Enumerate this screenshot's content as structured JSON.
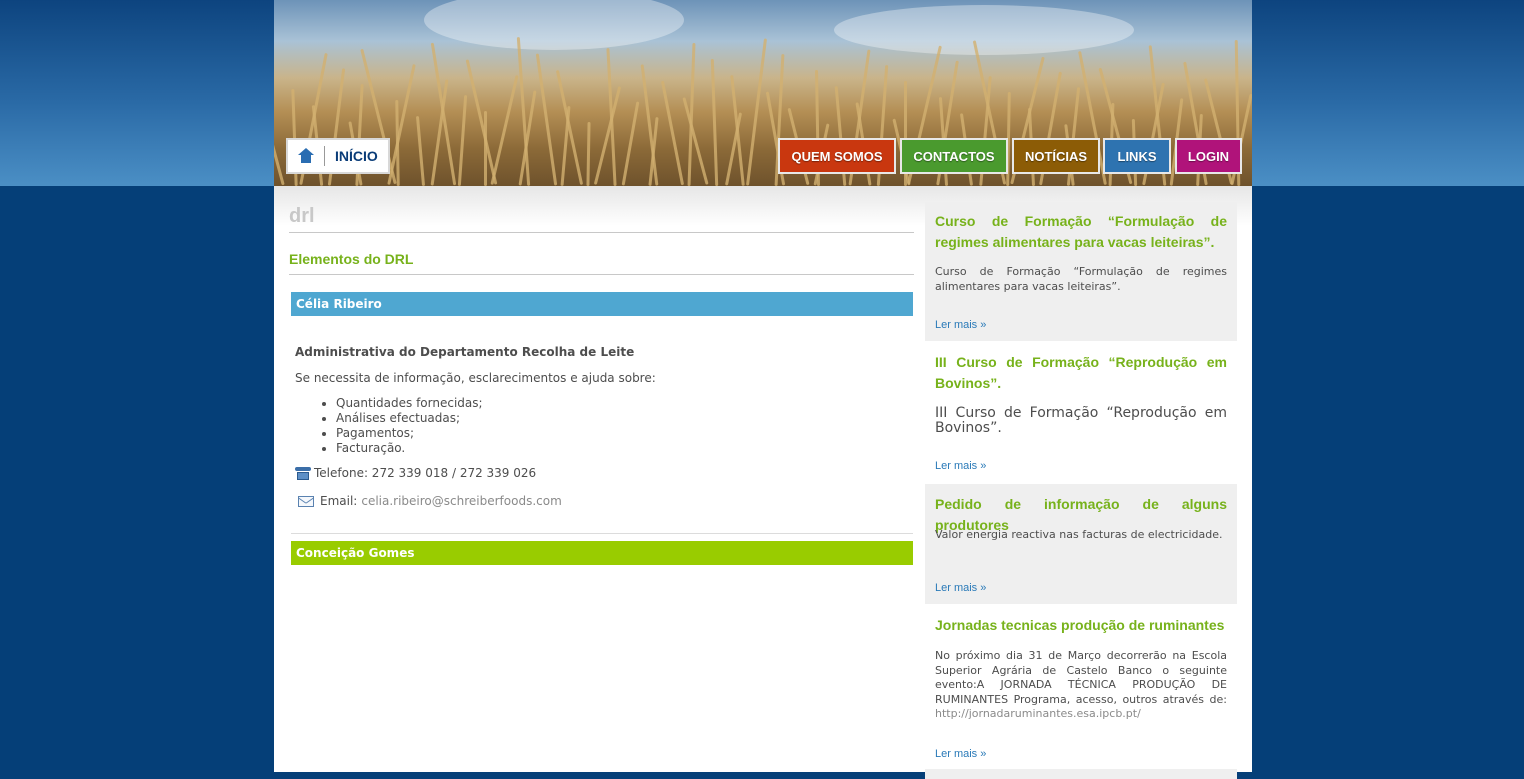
{
  "nav": {
    "home_label": "INÍCIO",
    "items": [
      {
        "label": "QUEM SOMOS",
        "color": "#c9370f"
      },
      {
        "label": "CONTACTOS",
        "color": "#4a9a2e"
      },
      {
        "label": "NOTÍCIAS",
        "color": "#8c5c06"
      },
      {
        "label": "LINKS",
        "color": "#2e73b0"
      },
      {
        "label": "LOGIN",
        "color": "#b0137a"
      }
    ]
  },
  "main": {
    "page_title": "drl",
    "section_title": "Elementos do DRL",
    "people": [
      {
        "name": "Célia Ribeiro",
        "color": "#4fa7d1",
        "role": "Administrativa do Departamento Recolha de Leite",
        "intro": "Se necessita de informação, esclarecimentos e ajuda sobre:",
        "topics": [
          "Quantidades fornecidas;",
          "Análises efectuadas;",
          "Pagamentos;",
          "Facturação."
        ],
        "phone": "Telefone: 272 339 018 / 272 339 026",
        "email_label": "Email:",
        "email": "celia.ribeiro@schreiberfoods.com"
      },
      {
        "name": "Conceição Gomes",
        "color": "#99cc00"
      }
    ]
  },
  "sidebar": {
    "more_label": "Ler mais »",
    "news": [
      {
        "title": "Curso de Formação “Formulação de regimes alimentares para vacas leiteiras”.",
        "body": "Curso de Formação “Formulação de regimes alimentares para vacas leiteiras”."
      },
      {
        "title": "III Curso de Formação “Reprodução em Bovinos”.",
        "body": " III Curso de Formação “Reprodução em Bovinos”."
      },
      {
        "title": "Pedido de informação de alguns produtores",
        "body": "Valor energia reactiva nas facturas de electricidade."
      },
      {
        "title": "Jornadas tecnicas produção de ruminantes",
        "body": "No próximo dia 31 de Março decorrerão na Escola Superior Agrária de Castelo Banco o seguinte evento:A JORNADA TÉCNICA PRODUÇÃO DE RUMINANTES  Programa, acesso, outros através de:",
        "link": "http://jornadaruminantes.esa.ipcb.pt/"
      }
    ]
  }
}
